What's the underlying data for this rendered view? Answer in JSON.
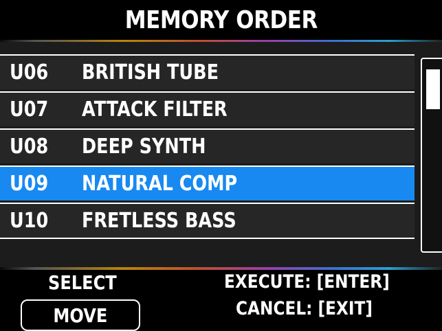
{
  "header": {
    "title": "MEMORY ORDER"
  },
  "memory_list": {
    "items": [
      {
        "id": "U06",
        "name": "BRITISH TUBE",
        "selected": false
      },
      {
        "id": "U07",
        "name": "ATTACK FILTER",
        "selected": false
      },
      {
        "id": "U08",
        "name": "DEEP SYNTH",
        "selected": false
      },
      {
        "id": "U09",
        "name": "NATURAL COMP",
        "selected": true
      },
      {
        "id": "U10",
        "name": "FRETLESS BASS",
        "selected": false
      }
    ]
  },
  "footer": {
    "select_label": "SELECT",
    "move_label": "MOVE",
    "execute_label": "EXECUTE: [ENTER]",
    "cancel_label": "CANCEL: [EXIT]"
  },
  "colors": {
    "selected_row": "#1889f0",
    "row_background": "#262626",
    "background": "#000000"
  }
}
